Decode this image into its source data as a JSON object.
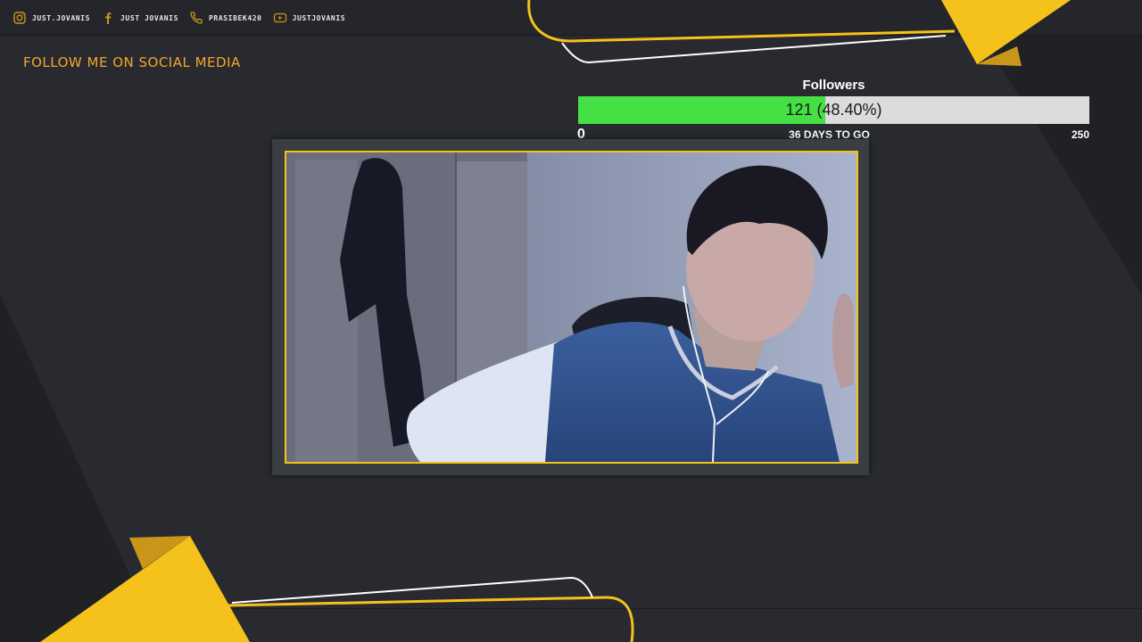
{
  "social": [
    {
      "icon": "instagram-icon",
      "label": "JUST.JOVANIS"
    },
    {
      "icon": "facebook-icon",
      "label": "JUST JOVANIS"
    },
    {
      "icon": "phone-icon",
      "label": "PRASIBEK420"
    },
    {
      "icon": "youtube-icon",
      "label": "JUSTJOVANIS"
    }
  ],
  "follow_text": "FOLLOW ME ON SOCIAL MEDIA",
  "goal": {
    "title": "Followers",
    "value_text": "121 (48.40%)",
    "progress": 0.484,
    "min_label": "0",
    "max_label": "250",
    "days_text": "36 DAYS TO GO"
  },
  "colors": {
    "accent": "#f5c21b",
    "background": "#24262b",
    "bar_fill": "#44e044",
    "bar_track": "#dcdcdc",
    "title_orange": "#f4a62a"
  }
}
